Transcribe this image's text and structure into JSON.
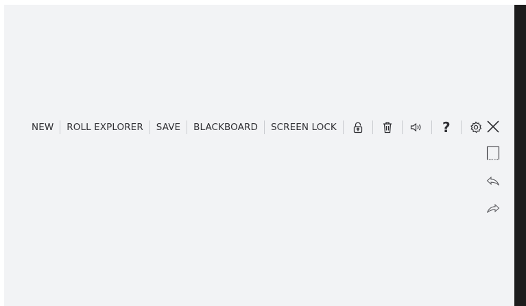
{
  "toolbar": {
    "new_label": "NEW",
    "roll_explorer_label": "ROLL EXPLORER",
    "save_label": "SAVE",
    "blackboard_label": "BLACKBOARD",
    "screen_lock_label": "SCREEN LOCK",
    "help_label": "?"
  },
  "icons": {
    "lock": "lock-icon",
    "delete": "trash-icon",
    "volume": "speaker-icon",
    "settings": "gear-icon",
    "close": "close-icon",
    "page": "page-icon",
    "undo": "undo-icon",
    "redo": "redo-icon"
  },
  "colors": {
    "background": "#f2f3f5",
    "text": "#2f2f33",
    "separator": "#c9cbcf",
    "edge": "#1d1d1d"
  }
}
